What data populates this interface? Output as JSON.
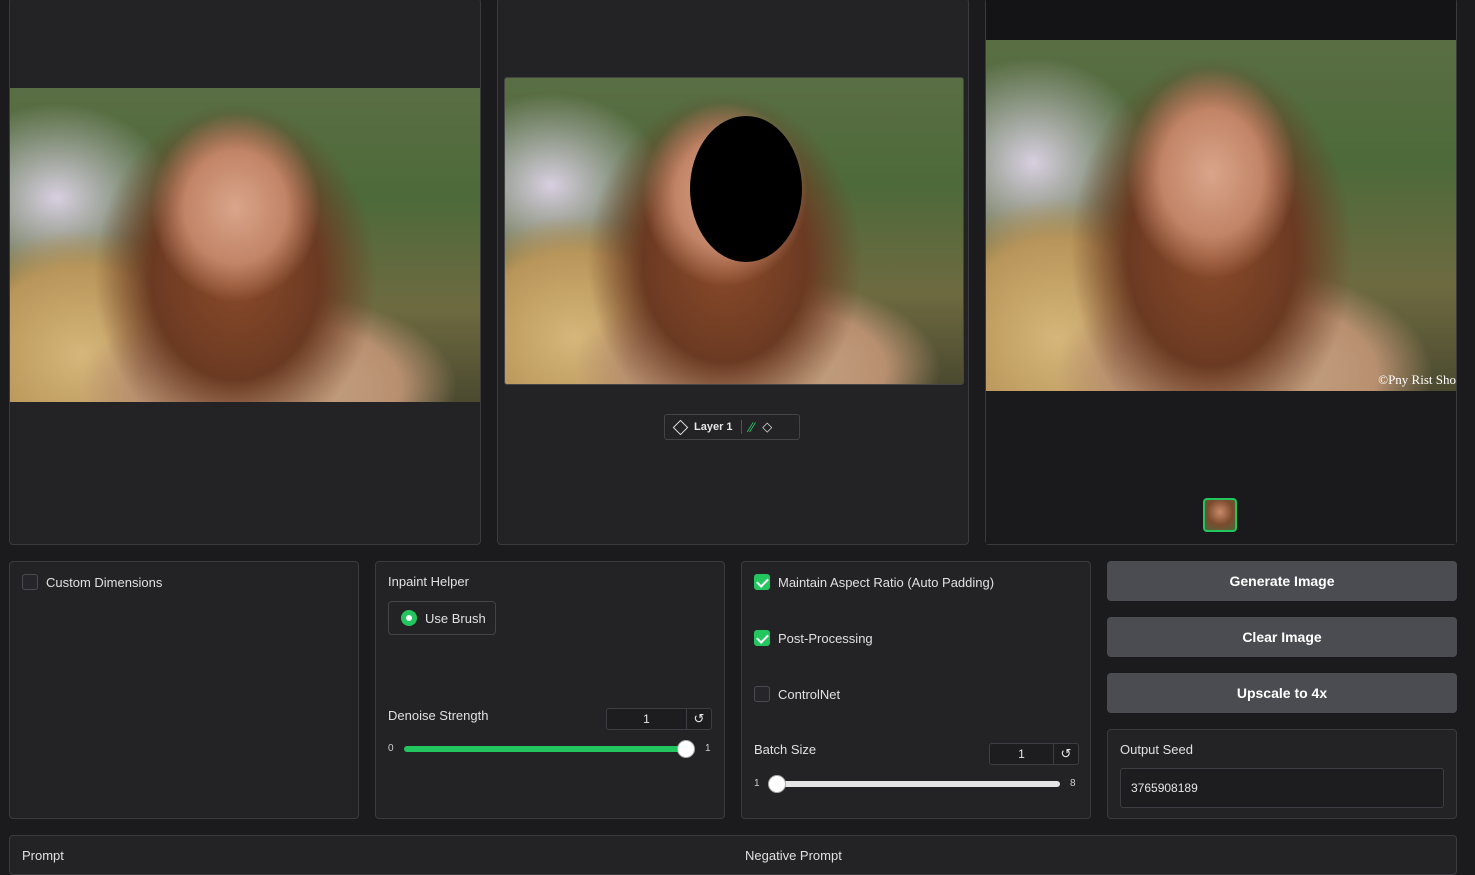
{
  "panels": {
    "input_image": {
      "icon": "portrait-photo"
    },
    "mask_editor": {
      "layer_label": "Layer 1",
      "mask_shape": "black-ellipse-over-face"
    },
    "output_image": {
      "watermark": "©Pny Rist Sho"
    }
  },
  "options": {
    "custom_dimensions": {
      "label": "Custom Dimensions",
      "checked": false
    }
  },
  "inpaint": {
    "title": "Inpaint Helper",
    "use_brush": {
      "label": "Use Brush",
      "selected": true
    },
    "denoise": {
      "label": "Denoise Strength",
      "value": "1",
      "min": "0",
      "max": "1",
      "fraction": 1.0
    }
  },
  "settings": {
    "maintain_aspect": {
      "label": "Maintain Aspect Ratio (Auto Padding)",
      "checked": true
    },
    "post_processing": {
      "label": "Post-Processing",
      "checked": true
    },
    "controlnet": {
      "label": "ControlNet",
      "checked": false
    },
    "batch_size": {
      "label": "Batch Size",
      "value": "1",
      "min": "1",
      "max": "8",
      "fraction": 0.0
    }
  },
  "actions": {
    "generate": "Generate Image",
    "clear": "Clear Image",
    "upscale": "Upscale to 4x",
    "seed_label": "Output Seed",
    "seed_value": "3765908189"
  },
  "prompts": {
    "prompt_label": "Prompt",
    "negative_label": "Negative Prompt"
  },
  "colors": {
    "accent": "#22c55e",
    "panel": "#232326",
    "button": "#4b4b52"
  }
}
